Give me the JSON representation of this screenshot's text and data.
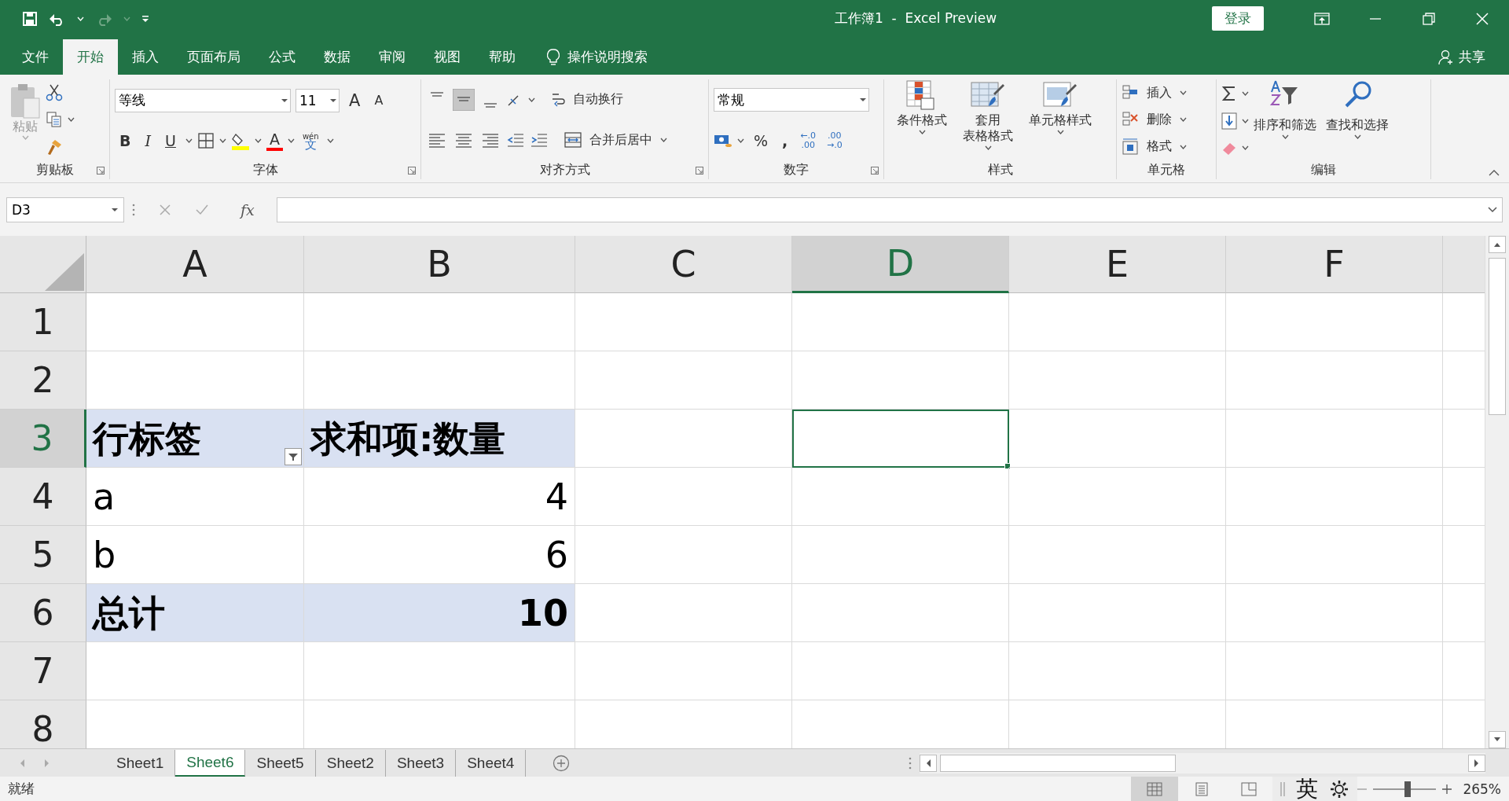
{
  "window": {
    "title": "工作簿1  -  Excel Preview",
    "sign_in": "登录"
  },
  "tabs": [
    {
      "label": "文件",
      "selected": false
    },
    {
      "label": "开始",
      "selected": true
    },
    {
      "label": "插入",
      "selected": false
    },
    {
      "label": "页面布局",
      "selected": false
    },
    {
      "label": "公式",
      "selected": false
    },
    {
      "label": "数据",
      "selected": false
    },
    {
      "label": "审阅",
      "selected": false
    },
    {
      "label": "视图",
      "selected": false
    },
    {
      "label": "帮助",
      "selected": false
    }
  ],
  "tell_me": "操作说明搜索",
  "share": "共享",
  "ribbon": {
    "clipboard": {
      "label": "剪贴板",
      "paste": "粘贴"
    },
    "font": {
      "label": "字体",
      "font_name": "等线",
      "font_size": "11",
      "grow": "A",
      "shrink": "A",
      "bold": "B",
      "italic": "I",
      "underline": "U",
      "font_color": "A",
      "pinyin": "wén",
      "phonetic": "文"
    },
    "alignment": {
      "label": "对齐方式",
      "wrap_text": "自动换行",
      "merge_center": "合并后居中"
    },
    "number": {
      "label": "数字",
      "format": "常规",
      "percent": "%",
      "comma": ",",
      "decimals": [
        {
          "top": "←.0",
          "bottom": ".00"
        },
        {
          "top": ".00",
          "bottom": "→.0"
        }
      ]
    },
    "styles": {
      "label": "样式",
      "buttons": [
        [
          "条件格式"
        ],
        [
          "套用",
          "表格格式"
        ],
        [
          "单元格样式"
        ]
      ]
    },
    "cells": {
      "label": "单元格",
      "buttons": [
        "插入",
        "删除",
        "格式"
      ]
    },
    "editing": {
      "label": "编辑",
      "buttons": [
        "排序和筛选",
        "查找和选择"
      ]
    }
  },
  "name_box": "D3",
  "function_label": "fx",
  "columns": [
    {
      "label": "A",
      "selected": false
    },
    {
      "label": "B",
      "selected": false
    },
    {
      "label": "C",
      "selected": false
    },
    {
      "label": "D",
      "selected": true
    },
    {
      "label": "E",
      "selected": false
    },
    {
      "label": "F",
      "selected": false
    }
  ],
  "rows": [
    {
      "header": "1",
      "selected": false,
      "kind": "plain",
      "cells": []
    },
    {
      "header": "2",
      "selected": false,
      "kind": "plain",
      "cells": []
    },
    {
      "header": "3",
      "selected": true,
      "kind": "pivot_header",
      "cells": [
        {
          "text": "行标签",
          "kind": "text"
        },
        {
          "text": "求和项:数量",
          "kind": "text"
        }
      ]
    },
    {
      "header": "4",
      "selected": false,
      "kind": "pivot_item",
      "cells": [
        {
          "text": "a",
          "kind": "text"
        },
        {
          "text": "4",
          "kind": "number"
        }
      ]
    },
    {
      "header": "5",
      "selected": false,
      "kind": "pivot_item",
      "cells": [
        {
          "text": "b",
          "kind": "text"
        },
        {
          "text": "6",
          "kind": "number"
        }
      ]
    },
    {
      "header": "6",
      "selected": false,
      "kind": "pivot_total",
      "cells": [
        {
          "text": "总计",
          "kind": "text"
        },
        {
          "text": "10",
          "kind": "number"
        }
      ]
    },
    {
      "header": "7",
      "selected": false,
      "kind": "plain",
      "cells": []
    },
    {
      "header": "8",
      "selected": false,
      "kind": "plain",
      "cells": []
    }
  ],
  "sheets": [
    {
      "label": "Sheet1",
      "selected": false
    },
    {
      "label": "Sheet6",
      "selected": true
    },
    {
      "label": "Sheet5",
      "selected": false
    },
    {
      "label": "Sheet2",
      "selected": false
    },
    {
      "label": "Sheet3",
      "selected": false
    },
    {
      "label": "Sheet4",
      "selected": false
    }
  ],
  "status_bar": {
    "text": "就绪",
    "views": [
      {
        "kind": "normal",
        "selected": true
      },
      {
        "kind": "page_layout",
        "selected": false
      },
      {
        "kind": "page_break",
        "selected": false
      }
    ],
    "ime": "英",
    "zoom": {
      "level": 0.55,
      "reading": "265%"
    }
  }
}
